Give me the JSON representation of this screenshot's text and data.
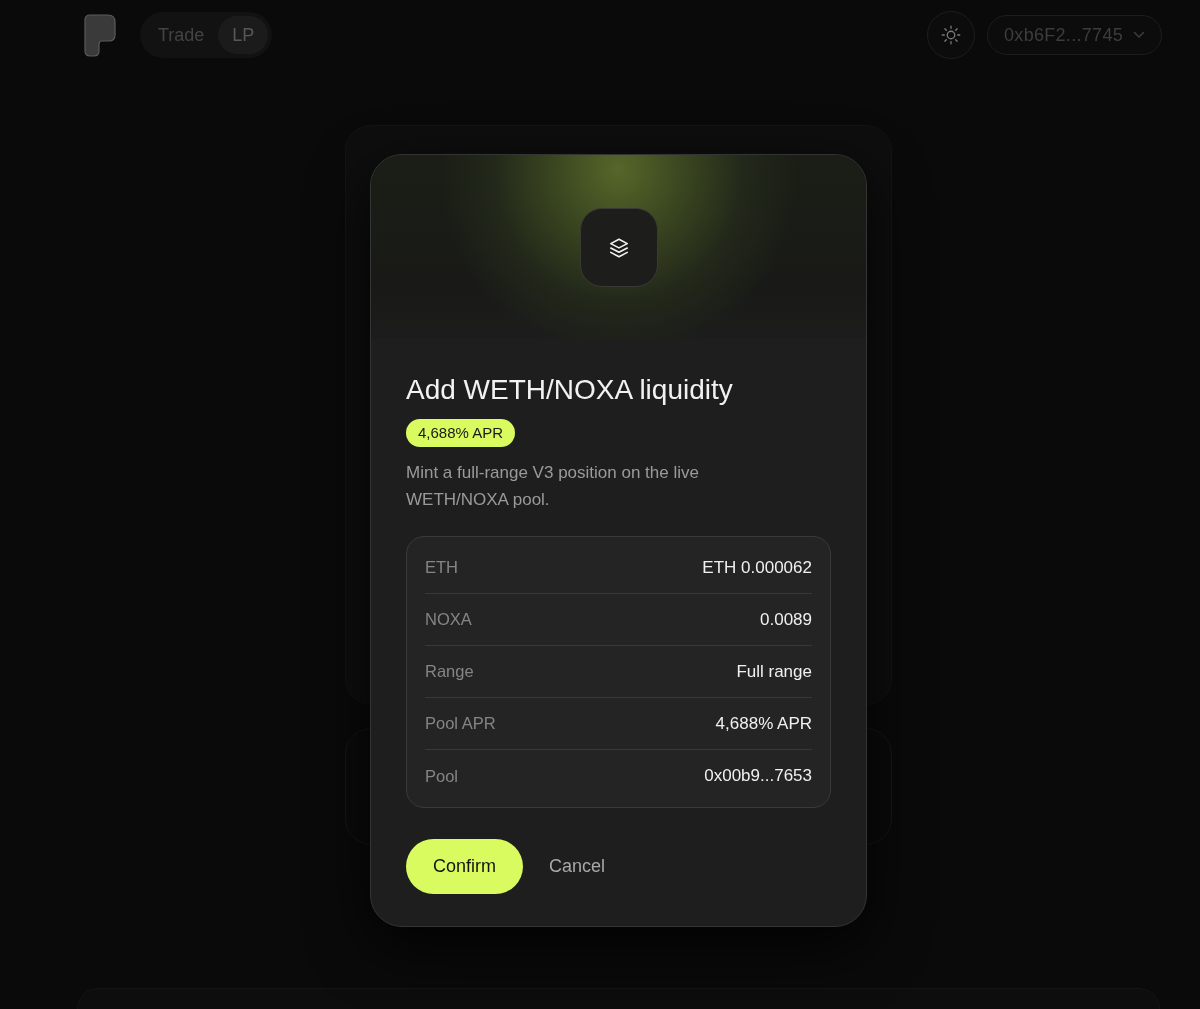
{
  "navbar": {
    "tabs": [
      {
        "label": "Trade",
        "selected": false
      },
      {
        "label": "LP",
        "selected": true
      }
    ],
    "wallet": {
      "address": "0xb6F2...7745"
    }
  },
  "modal": {
    "title": "Add WETH/NOXA liquidity",
    "badge": "4,688% APR",
    "description": "Mint a full-range V3 position on the live WETH/NOXA pool.",
    "details": [
      {
        "label": "ETH",
        "value": "ETH 0.000062"
      },
      {
        "label": "NOXA",
        "value": "0.0089"
      },
      {
        "label": "Range",
        "value": "Full range"
      },
      {
        "label": "Pool APR",
        "value": "4,688% APR"
      },
      {
        "label": "Pool",
        "value": "0x00b9...7653"
      }
    ],
    "buttons": [
      {
        "label": "Confirm",
        "kind": "primary"
      },
      {
        "label": "Cancel",
        "kind": "text"
      }
    ]
  }
}
